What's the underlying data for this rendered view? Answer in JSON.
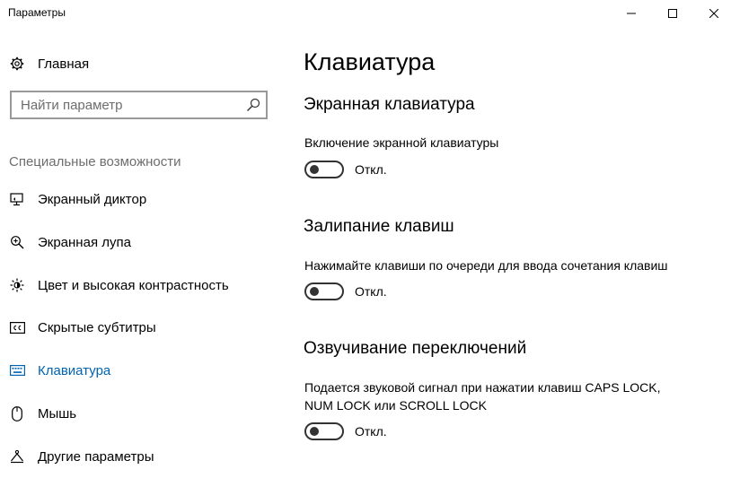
{
  "window": {
    "title": "Параметры"
  },
  "sidebar": {
    "home_label": "Главная",
    "search_placeholder": "Найти параметр",
    "section_label": "Специальные возможности",
    "items": [
      {
        "label": "Экранный диктор",
        "icon": "narrator-icon",
        "active": false
      },
      {
        "label": "Экранная лупа",
        "icon": "magnifier-icon",
        "active": false
      },
      {
        "label": "Цвет и высокая контрастность",
        "icon": "brightness-icon",
        "active": false
      },
      {
        "label": "Скрытые субтитры",
        "icon": "closed-captions-icon",
        "active": false
      },
      {
        "label": "Клавиатура",
        "icon": "keyboard-icon",
        "active": true
      },
      {
        "label": "Мышь",
        "icon": "mouse-icon",
        "active": false
      },
      {
        "label": "Другие параметры",
        "icon": "other-options-icon",
        "active": false
      }
    ]
  },
  "main": {
    "title": "Клавиатура",
    "sections": [
      {
        "heading": "Экранная клавиатура",
        "description": "Включение экранной клавиатуры",
        "toggle_state": "Откл."
      },
      {
        "heading": "Залипание клавиш",
        "description": "Нажимайте клавиши по очереди для ввода сочетания клавиш",
        "toggle_state": "Откл."
      },
      {
        "heading": "Озвучивание переключений",
        "description_line1": "Подается звуковой сигнал при нажатии клавиш CAPS LOCK,",
        "description_line2": "NUM LOCK или SCROLL LOCK",
        "toggle_state": "Откл."
      }
    ]
  },
  "colors": {
    "accent": "#0063b1",
    "muted_text": "#6d6d6d",
    "search_border": "#999999"
  }
}
